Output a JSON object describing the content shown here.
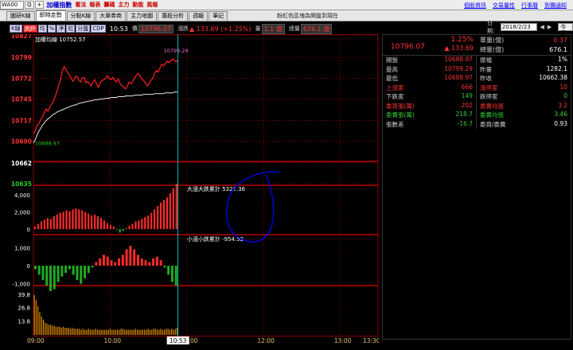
{
  "toolbar": {
    "symbol": "WA00",
    "search": "Q",
    "plus": "+",
    "menus": [
      "加權指數",
      "看法",
      "報表",
      "籌碼",
      "主力",
      "動能",
      "風報"
    ],
    "links": [
      "個股資訊",
      "交易屬性",
      "行事曆",
      "到價通知"
    ]
  },
  "tabs": [
    "圖研K線",
    "即時走勢",
    "分點K線",
    "大單券商",
    "主力地圖",
    "籌股分析",
    "週報",
    "筆記"
  ],
  "active_tab": 1,
  "note": "粉紅色區塊為開盤到現在",
  "chart_bar": {
    "buttons": [
      "K線",
      "大戶",
      "均",
      "%",
      "淨",
      "虹",
      "分盤",
      "CDP"
    ],
    "active": [
      1
    ],
    "time": "10:53",
    "price_label": "價",
    "price": "10796.07",
    "change_label": "漲跌",
    "change": "▲ 133.69 (+1.25%)",
    "volume_label": "量",
    "volume": "1.1 億",
    "total_label": "總量",
    "total": "676.1 億"
  },
  "chart": {
    "colors": {
      "price": "#ff2020",
      "avg": "#e8e8e8",
      "grid": "#8b0000",
      "up": "#ff2a2a",
      "down": "#22aa22",
      "cursor": "#00e5e5",
      "annot": "#0000cc"
    },
    "price_title": "加權均線 10752.57",
    "hi_mark": "10799.29",
    "lo_mark": "10688.97",
    "y_ticks": [
      10827,
      10799,
      10772,
      10745,
      10717,
      10690,
      10662,
      10635
    ],
    "price_line": [
      10700,
      10704,
      10711,
      10713,
      10718,
      10722,
      10727,
      10732,
      10729,
      10734,
      10738,
      10742,
      10748,
      10755,
      10763,
      10770,
      10781,
      10787,
      10783,
      10779,
      10776,
      10771,
      10768,
      10773,
      10775,
      10770,
      10767,
      10772,
      10773,
      10766,
      10768,
      10765,
      10762,
      10768,
      10770,
      10764,
      10760,
      10766,
      10769,
      10770,
      10772,
      10775,
      10772,
      10770,
      10773,
      10769,
      10767,
      10771,
      10765,
      10762,
      10760,
      10758,
      10762,
      10767,
      10765,
      10768,
      10772,
      10776,
      10778,
      10775,
      10771,
      10769,
      10766,
      10762,
      10765,
      10769,
      10772,
      10778,
      10782,
      10780,
      10785,
      10790,
      10788,
      10791,
      10794,
      10792,
      10795,
      10797,
      10795,
      10793,
      10796
    ],
    "avg_line": [
      10688,
      10692,
      10698,
      10703,
      10707,
      10711,
      10714,
      10717,
      10719,
      10721,
      10723,
      10725,
      10726,
      10728,
      10729,
      10730,
      10731,
      10732,
      10733,
      10734,
      10735,
      10736,
      10737,
      10737,
      10738,
      10739,
      10740,
      10740,
      10741,
      10741,
      10742,
      10742,
      10743,
      10743,
      10744,
      10744,
      10744,
      10745,
      10745,
      10745,
      10746,
      10746,
      10746,
      10747,
      10747,
      10747,
      10747,
      10748,
      10748,
      10748,
      10748,
      10749,
      10749,
      10749,
      10749,
      10749,
      10750,
      10750,
      10750,
      10750,
      10750,
      10751,
      10751,
      10751,
      10751,
      10751,
      10751,
      10752,
      10752,
      10752,
      10752,
      10752,
      10752,
      10753,
      10753,
      10753,
      10753,
      10753,
      10754,
      10754,
      10754
    ],
    "big_title": "大漲大跌累計 5327.36",
    "big_ticks": [
      "4,000",
      "2,000",
      "0"
    ],
    "big_vals": [
      300,
      600,
      900,
      1100,
      1300,
      1200,
      1500,
      1700,
      1900,
      2000,
      2200,
      2100,
      2300,
      2400,
      2300,
      2200,
      2000,
      1800,
      1600,
      1700,
      1500,
      1300,
      1000,
      700,
      500,
      300,
      -100,
      -400,
      -200,
      100,
      400,
      600,
      900,
      1000,
      1200,
      1400,
      1600,
      1900,
      2300,
      2700,
      3100,
      3400,
      3700,
      4200,
      4800,
      5300
    ],
    "small_title": "小漲小跌累計 -954.52",
    "small_ticks": [
      "1,000",
      "0",
      "-1,000"
    ],
    "small_vals": [
      -200,
      -500,
      -800,
      -1100,
      -1400,
      -1300,
      -900,
      -600,
      -400,
      -200,
      -500,
      -800,
      -1000,
      -700,
      -400,
      -100,
      200,
      400,
      600,
      500,
      300,
      200,
      400,
      600,
      900,
      1100,
      900,
      600,
      400,
      300,
      200,
      400,
      500,
      300,
      -100,
      -500,
      -900,
      -1100
    ],
    "vol_ticks": [
      "39.8",
      "26.8",
      "13.8"
    ],
    "vol_vals": [
      39,
      34,
      28,
      22,
      18,
      15,
      12,
      11,
      10,
      10,
      9,
      9,
      8,
      8,
      8,
      7,
      8,
      7,
      7,
      7,
      6,
      7,
      6,
      6,
      6,
      6,
      5,
      6,
      5,
      5,
      6,
      5,
      5,
      5,
      6,
      5,
      5,
      5,
      5,
      5,
      5,
      5,
      6,
      5,
      5,
      5,
      5,
      5,
      6,
      6,
      5,
      5,
      5,
      5,
      5,
      5,
      6,
      5,
      5,
      5,
      5,
      5,
      5,
      6,
      5,
      5,
      6,
      6,
      5,
      5,
      6,
      5,
      5,
      6,
      6,
      5,
      6,
      5,
      6,
      7
    ],
    "x_ticks": [
      {
        "label": "09:00",
        "t": 0
      },
      {
        "label": "10:00",
        "t": 60
      },
      {
        "label": "11:00",
        "t": 120
      },
      {
        "label": "12:00",
        "t": 180
      },
      {
        "label": "13:00",
        "t": 240
      },
      {
        "label": "13:30",
        "t": 270
      }
    ],
    "cursor_time": "10:53",
    "cursor_t": 113
  },
  "side": {
    "date_label": "日期:",
    "date": "2018/2/23",
    "today": "今天",
    "nav": [
      "◀",
      "▶"
    ],
    "pct": "1.25%",
    "price": "10796.07",
    "change": "▲ 133.69",
    "unit_vol_label": "單量(億)",
    "unit_vol": "0.37",
    "total_vol_label": "總量(億)",
    "total_vol": "676.1",
    "rows": [
      [
        {
          "k": "開盤",
          "v": "10688.97",
          "c": "red"
        },
        {
          "k": "振幅",
          "v": "1%",
          "c": ""
        }
      ],
      [
        {
          "k": "最高",
          "v": "10799.29",
          "c": "red"
        },
        {
          "k": "昨量",
          "v": "1282.1",
          "c": ""
        }
      ],
      [
        {
          "k": "最低",
          "v": "10688.97",
          "c": "red"
        },
        {
          "k": "昨收",
          "v": "10662.38",
          "c": ""
        }
      ],
      [
        {
          "k": "上漲家",
          "v": "666",
          "c": "red",
          "kc": "red"
        },
        {
          "k": "漲停家",
          "v": "10",
          "c": "red",
          "kc": "red"
        }
      ],
      [
        {
          "k": "下跌家",
          "v": "149",
          "c": "grn",
          "kc": ""
        },
        {
          "k": "跌停家",
          "v": "0",
          "c": "grn",
          "kc": ""
        }
      ],
      [
        {
          "k": "委買張(萬)",
          "v": "202",
          "c": "red",
          "kc": "red"
        },
        {
          "k": "委賣均張",
          "v": "3.2",
          "c": "red",
          "kc": "red"
        }
      ],
      [
        {
          "k": "委賣張(萬)",
          "v": "218.7",
          "c": "grn",
          "kc": "grn"
        },
        {
          "k": "委賣均張",
          "v": "3.46",
          "c": "grn",
          "kc": "grn"
        }
      ],
      [
        {
          "k": "張數差",
          "v": "-16.7",
          "c": "grn",
          "kc": ""
        },
        {
          "k": "委買/委賣",
          "v": "0.93",
          "c": "",
          "kc": ""
        }
      ]
    ]
  }
}
